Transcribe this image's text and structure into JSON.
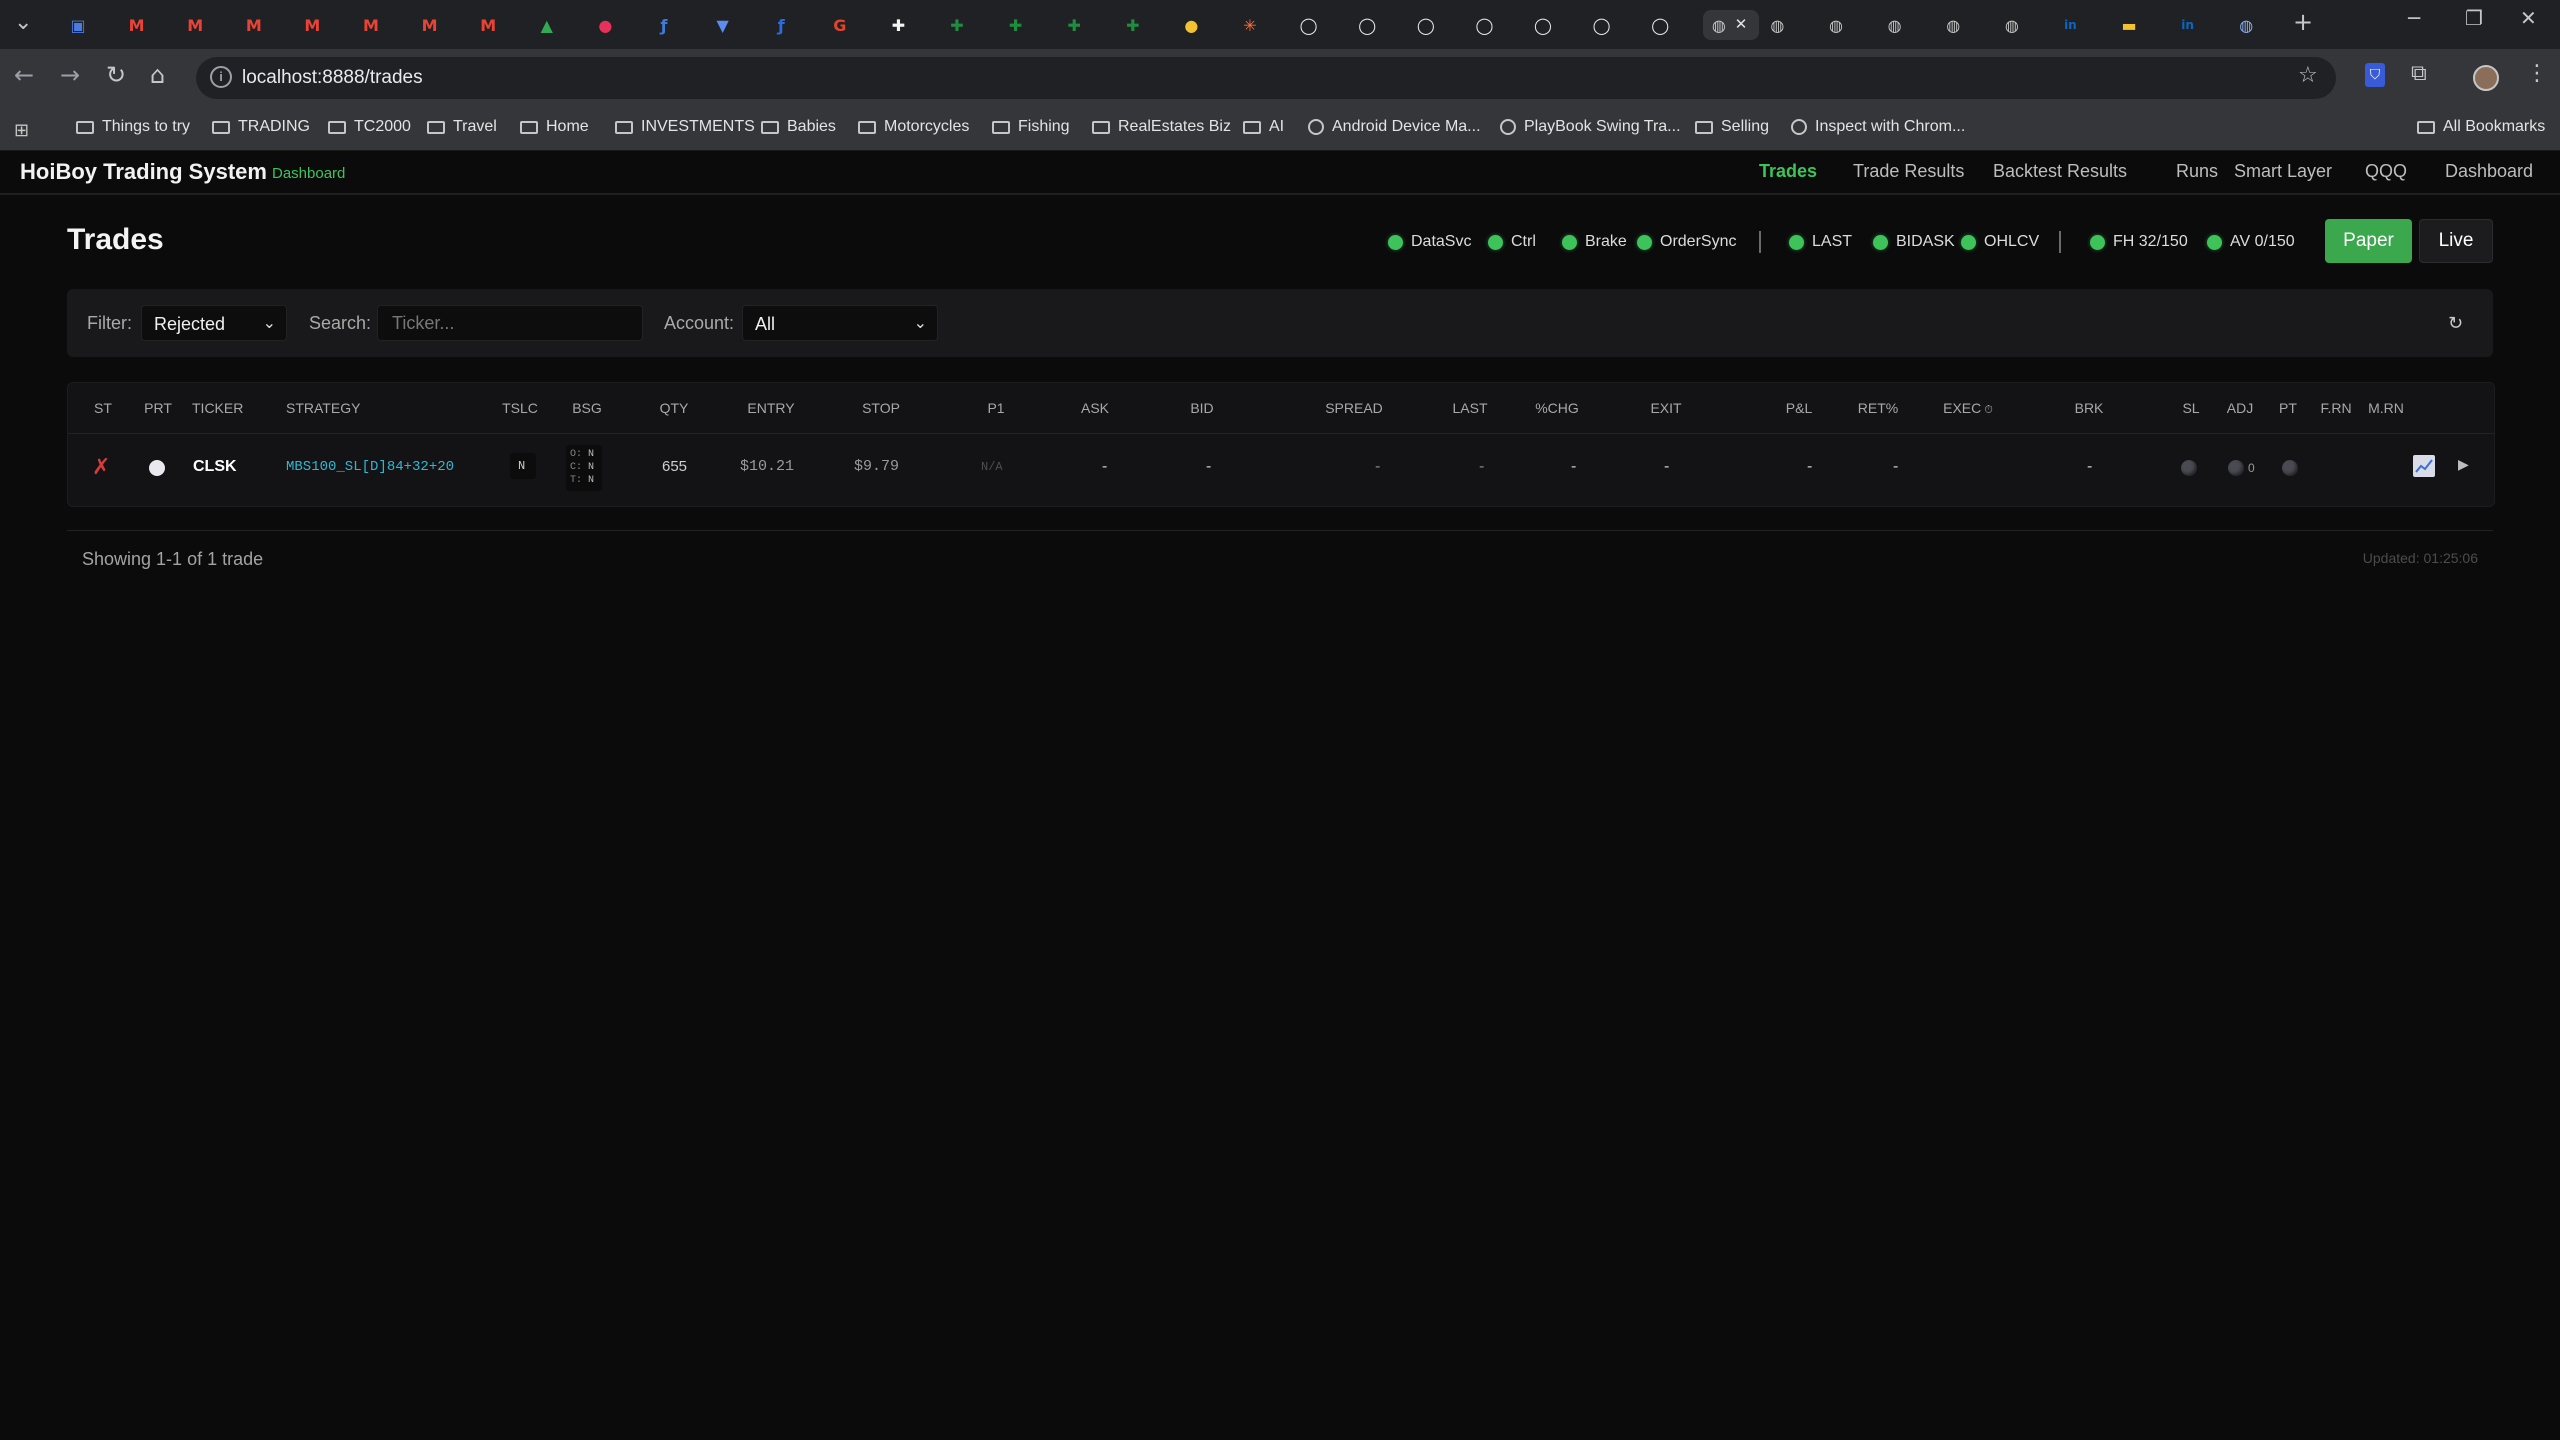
{
  "browser": {
    "url": "localhost:8888/trades",
    "bookmarks": [
      "Things to try",
      "TRADING",
      "TC2000",
      "Travel",
      "Home",
      "INVESTMENTS",
      "Babies",
      "Motorcycles",
      "Fishing",
      "RealEstates Biz",
      "AI",
      "Android Device Ma...",
      "PlayBook Swing Tra...",
      "Selling",
      "Inspect with Chrom...",
      "All Bookmarks"
    ]
  },
  "app": {
    "brand": "HoiBoy Trading System",
    "brand_sub": "Dashboard",
    "nav": [
      "Trades",
      "Trade Results",
      "Backtest Results",
      "Runs",
      "Smart Layer",
      "QQQ",
      "Dashboard"
    ]
  },
  "page": {
    "title": "Trades",
    "status": {
      "group1": [
        "DataSvc",
        "Ctrl",
        "Brake",
        "OrderSync"
      ],
      "group2": [
        "LAST",
        "BIDASK",
        "OHLCV"
      ],
      "group3": [
        "FH 32/150",
        "AV 0/150"
      ],
      "color": "#3ec35b"
    },
    "mode": {
      "paper": "Paper",
      "live": "Live"
    }
  },
  "filters": {
    "filter_label": "Filter:",
    "filter_value": "Rejected",
    "search_label": "Search:",
    "search_placeholder": "Ticker...",
    "account_label": "Account:",
    "account_value": "All"
  },
  "table": {
    "columns": [
      "ST",
      "PRT",
      "TICKER",
      "STRATEGY",
      "TSLC",
      "BSG",
      "QTY",
      "ENTRY",
      "STOP",
      "P1",
      "ASK",
      "BID",
      "SPREAD",
      "LAST",
      "%CHG",
      "EXIT",
      "P&L",
      "RET%",
      "EXEC",
      "BRK",
      "SL",
      "ADJ",
      "PT",
      "F.RN",
      "M.RN"
    ],
    "exec_icon": "clock-icon",
    "row": {
      "st": "✗",
      "ticker": "CLSK",
      "strategy": "MBS100_SL[D]84+32+20",
      "tslc": "N",
      "bsg": [
        [
          "O:",
          "N"
        ],
        [
          "C:",
          "N"
        ],
        [
          "T:",
          "N"
        ]
      ],
      "qty": "655",
      "entry": "$10.21",
      "stop": "$9.79",
      "p1": "N/A",
      "ask": "-",
      "bid": "-",
      "spread": "-",
      "last": "-",
      "chg": "-",
      "exit": "-",
      "pnl": "-",
      "ret": "-",
      "brk": "-",
      "adj": "0",
      "colors": {
        "reject": "#d93a3a",
        "strategy": "#2fb8d6"
      }
    }
  },
  "footer": {
    "showing": "Showing 1-1 of 1 trade",
    "updated": "Updated: 01:25:06"
  }
}
